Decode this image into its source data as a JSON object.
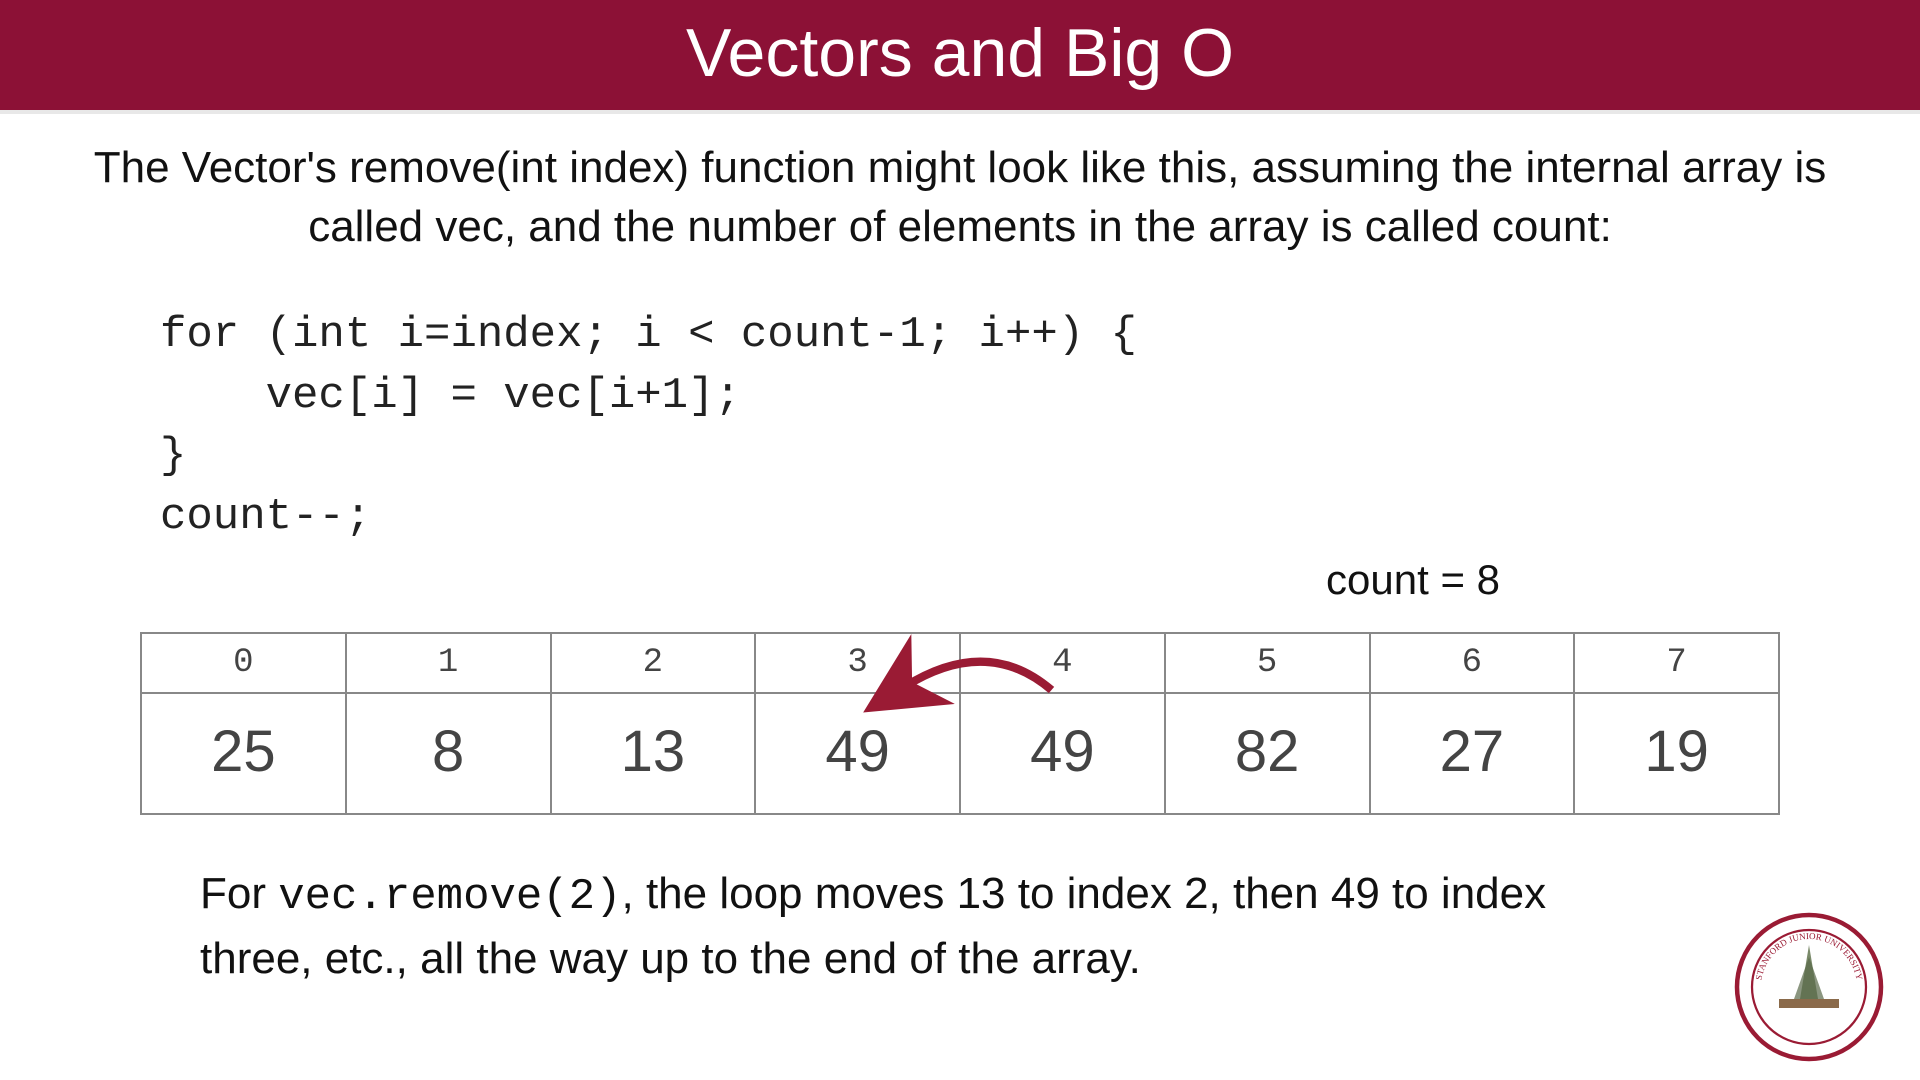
{
  "title": "Vectors and Big O",
  "subtitle": "The Vector's remove(int index) function might look like this, assuming the internal array is called vec, and the number of elements in the array is called count:",
  "code": "for (int i=index; i < count-1; i++) {\n    vec[i] = vec[i+1];\n}\ncount--;",
  "count_label": "count = 8",
  "array": {
    "indices": [
      "0",
      "1",
      "2",
      "3",
      "4",
      "5",
      "6",
      "7"
    ],
    "values": [
      "25",
      "8",
      "13",
      "49",
      "49",
      "82",
      "27",
      "19"
    ]
  },
  "explain_prefix": "For ",
  "explain_code": "vec.remove(2)",
  "explain_suffix": ", the loop moves 13 to index 2, then 49 to index three, etc., all the way up to the end of the array.",
  "logo_text": "STANFORD JUNIOR UNIVERSITY"
}
